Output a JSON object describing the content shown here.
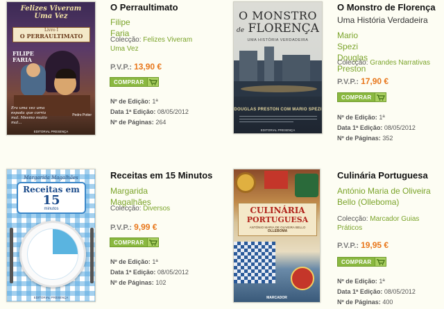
{
  "labels": {
    "colec": "Colecção:",
    "pvp": "P.V.P.:",
    "comprar": "COMPRAR",
    "edicao": "Nº de Edição:",
    "data_edicao": "Data 1ª Edição:",
    "paginas": "Nº de Páginas:"
  },
  "books": [
    {
      "title": "O Perraultimato",
      "authors": [
        "Filipe Faria"
      ],
      "collection": "Felizes Viveram Uma Vez",
      "price": "13,90 €",
      "edition": "1ª",
      "first_edition_date": "08/05/2012",
      "pages": "264",
      "cover": {
        "top": "Felizes Viveram Uma Vez",
        "book": "Livro I",
        "title": "O PERRAULTIMATO",
        "author": "FILIPE FARIA",
        "blurb": "Era uma vez uma espada que corria mal. Mesmo muito mal...",
        "illustrator": "Pedro Potier",
        "publisher": "EDITORIAL PRESENÇA"
      }
    },
    {
      "title": "O Monstro de Florença",
      "subtitle": "Uma História Verdadeira",
      "authors": [
        "Mario Spezi",
        "Douglas Preston"
      ],
      "collection": "Grandes Narrativas",
      "price": "17,90 €",
      "edition": "1ª",
      "first_edition_date": "08/05/2012",
      "pages": "352",
      "cover": {
        "title_1": "O MONSTRO",
        "title_2": "FLORENÇA",
        "title_de": "de",
        "tagline": "UMA HISTÓRIA VERDADEIRA",
        "authors": "DOUGLAS PRESTON COM MARIO SPEZI",
        "publisher": "EDITORIAL PRESENÇA"
      }
    },
    {
      "title": "Receitas em 15 Minutos",
      "authors": [
        "Margarida Magalhães"
      ],
      "collection": "Diversos",
      "price": "9,99 €",
      "edition": "1ª",
      "first_edition_date": "08/05/2012",
      "pages": "102",
      "cover": {
        "author": "Margarida Magalhães",
        "title": "Receitas em",
        "number": "15",
        "unit": "minutos",
        "publisher": "EDITORIAL PRESENÇA"
      }
    },
    {
      "title": "Culinária Portuguesa",
      "authors": [
        "António Maria de Oliveira Bello (Olleboma)"
      ],
      "collection": "Marcador Guias Práticos",
      "price": "19,95 €",
      "edition": "1ª",
      "first_edition_date": "08/05/2012",
      "pages": "400",
      "cover": {
        "title_1": "CULINÁRIA",
        "title_2": "PORTUGUESA",
        "author": "ANTÓNIO MARIA DE OLIVEIRA BELLO",
        "author_alias": "OLLEBOMA",
        "publisher": "MARCADOR"
      }
    }
  ]
}
